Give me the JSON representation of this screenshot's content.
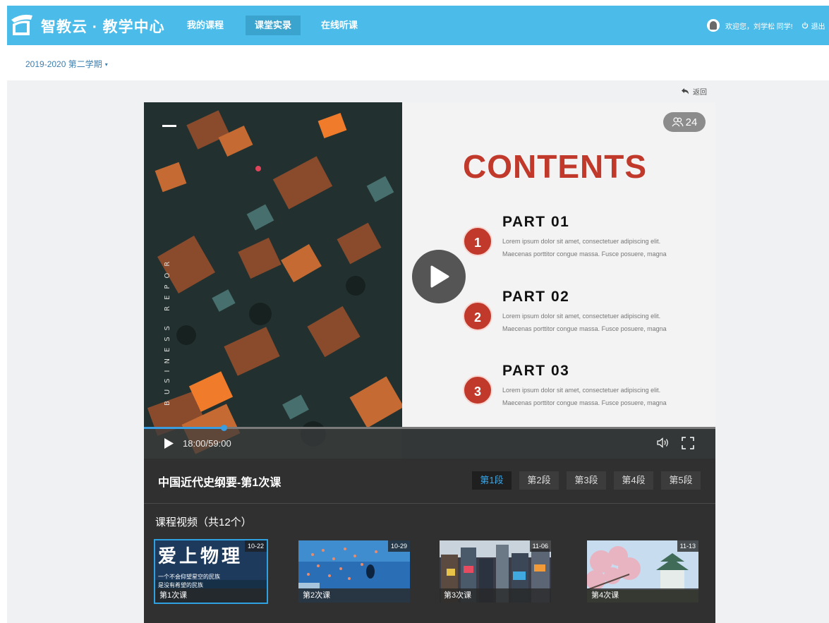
{
  "header": {
    "logo_text": "智教云 · 教学中心",
    "nav": [
      {
        "label": "我的课程"
      },
      {
        "label": "课堂实录"
      },
      {
        "label": "在线听课"
      }
    ],
    "user_greeting": "欢迎您，刘学松 同学!",
    "logout": "退出"
  },
  "semester": {
    "label": "2019-2020 第二学期"
  },
  "back_label": "返回",
  "player": {
    "viewer_count": "24",
    "time": "18:00/59:00",
    "progress": 0.14,
    "aerial_vertical_text": "BUSINESS REPOR",
    "slide": {
      "title": "CONTENTS",
      "parts": [
        {
          "num": "1",
          "title": "PART 01",
          "line1": "Lorem ipsum dolor sit amet, consectetuer adipiscing elit.",
          "line2": "Maecenas porttitor congue massa. Fusce posuere, magna"
        },
        {
          "num": "2",
          "title": "PART 02",
          "line1": "Lorem ipsum dolor sit amet, consectetuer adipiscing elit.",
          "line2": "Maecenas porttitor congue massa. Fusce posuere, magna"
        },
        {
          "num": "3",
          "title": "PART 03",
          "line1": "Lorem ipsum dolor sit amet, consectetuer adipiscing elit.",
          "line2": "Maecenas porttitor congue massa. Fusce posuere, magna"
        }
      ]
    }
  },
  "course": {
    "title": "中国近代史纲要-第1次课",
    "segments": [
      "第1段",
      "第2段",
      "第3段",
      "第4段",
      "第5段"
    ],
    "videos_heading": "课程视频（共12个）",
    "videos": [
      {
        "label": "第1次课",
        "date": "10-22",
        "title_text": "爱上物理",
        "sub1": "一个不会仰望星空的民族",
        "sub2": "是没有希望的民族"
      },
      {
        "label": "第2次课",
        "date": "10-29"
      },
      {
        "label": "第3次课",
        "date": "11-06"
      },
      {
        "label": "第4次课",
        "date": "11-13"
      }
    ]
  },
  "colors": {
    "header_bg": "#4bbce9",
    "accent_red": "#c0392b",
    "progress_blue": "#3a9de0",
    "panel_bg": "#303030"
  }
}
